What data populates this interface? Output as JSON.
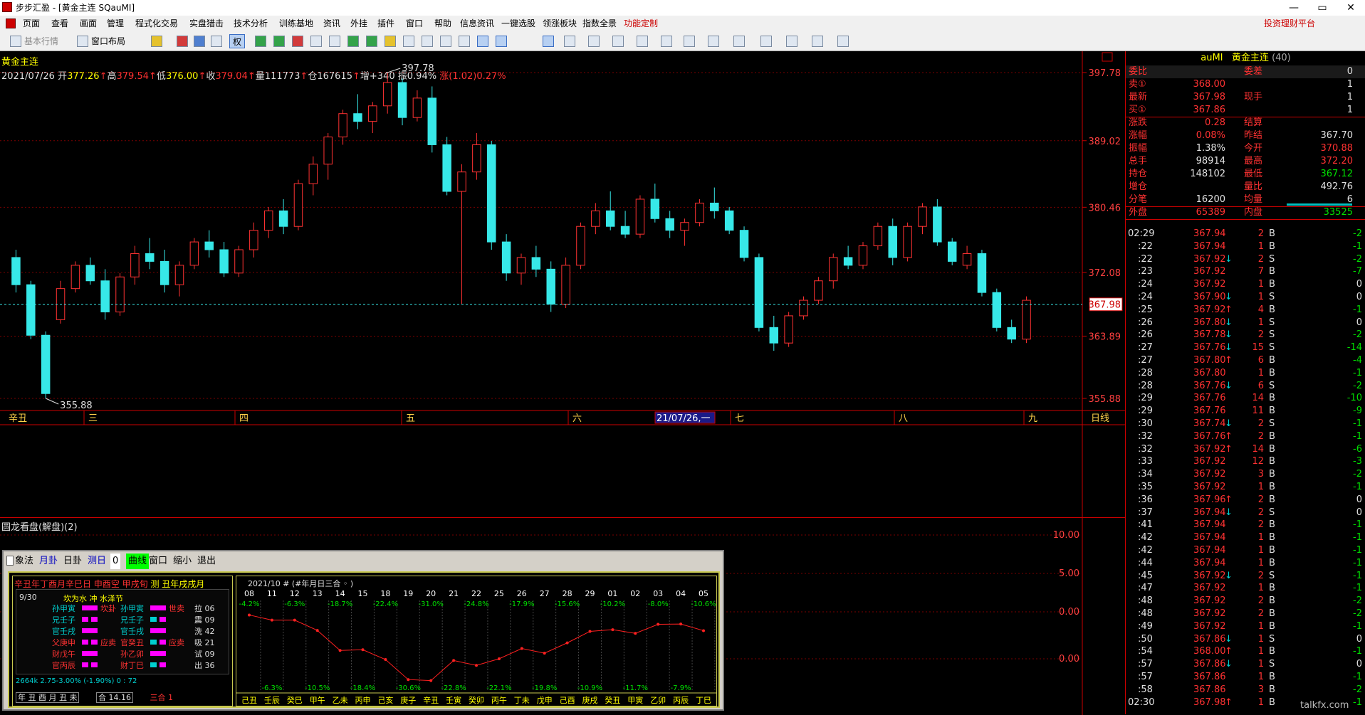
{
  "window": {
    "title": "步步汇盈 - [黄金主连 SQauMI]",
    "min": "—",
    "max": "▭",
    "close": "✕"
  },
  "menu": {
    "items": [
      "页面",
      "查看",
      "画面",
      "管理",
      "程式化交易",
      "实盘猎击",
      "技术分析",
      "训练基地",
      "资讯",
      "外挂",
      "插件",
      "窗口",
      "帮助",
      "信息资讯",
      "一键选股",
      "领涨板块",
      "指数全景",
      "功能定制"
    ],
    "platform": "投资理财平台"
  },
  "toolbar": {
    "basic_quotes": "基本行情",
    "window_layout": "窗口布局",
    "quan": "权"
  },
  "chart": {
    "title": "黄金主连",
    "date": "2021/07/26",
    "open_label": "开",
    "open": "377.26",
    "high_label": "高",
    "high": "379.54",
    "low_label": "低",
    "low": "376.00",
    "close_label": "收",
    "close": "379.04",
    "vol_label": "量",
    "vol": "111773",
    "oi_label": "仓",
    "oi": "167615",
    "inc_label": "增",
    "inc": "+340",
    "amp_label": "振",
    "amp": "0.94%",
    "chg_label": "涨",
    "chg": "(1.02)0.27%",
    "current_price": "367.98",
    "peak_label": "397.78",
    "trough_label": "355.88",
    "axis_ticks": [
      "397.78",
      "389.02",
      "380.46",
      "372.08",
      "363.89",
      "355.88"
    ],
    "x_labels": [
      "辛丑",
      "三",
      "四",
      "五",
      "六",
      "21/07/26,一",
      "七",
      "八",
      "九"
    ],
    "period_label": "日线",
    "colors": {
      "up": "#ff3232",
      "down": "#37e8e8",
      "bg": "#000000"
    }
  },
  "chart_data": {
    "type": "candlestick",
    "title": "黄金主连",
    "ylim": [
      355.88,
      397.78
    ],
    "candles": [
      [
        374.0,
        375.0,
        369.5,
        370.5
      ],
      [
        370.5,
        371.0,
        363.5,
        364.0
      ],
      [
        364.0,
        364.5,
        355.88,
        356.5
      ],
      [
        366.0,
        371.0,
        365.5,
        370.0
      ],
      [
        370.0,
        373.5,
        369.5,
        373.0
      ],
      [
        373.0,
        374.0,
        370.5,
        371.0
      ],
      [
        371.0,
        372.5,
        366.0,
        367.0
      ],
      [
        367.0,
        372.0,
        366.5,
        371.5
      ],
      [
        371.5,
        375.5,
        370.5,
        374.5
      ],
      [
        374.5,
        376.5,
        372.5,
        373.5
      ],
      [
        373.5,
        375.0,
        369.5,
        370.5
      ],
      [
        370.5,
        373.5,
        369.0,
        373.0
      ],
      [
        373.0,
        376.5,
        372.5,
        376.0
      ],
      [
        376.0,
        377.5,
        374.0,
        375.0
      ],
      [
        375.0,
        376.0,
        371.5,
        372.0
      ],
      [
        372.0,
        375.5,
        371.5,
        375.0
      ],
      [
        375.0,
        378.5,
        374.0,
        377.5
      ],
      [
        377.5,
        380.5,
        376.5,
        380.0
      ],
      [
        380.0,
        381.5,
        377.0,
        378.0
      ],
      [
        378.0,
        384.0,
        377.5,
        383.5
      ],
      [
        383.5,
        387.0,
        382.0,
        386.0
      ],
      [
        386.0,
        390.0,
        384.0,
        389.5
      ],
      [
        389.5,
        393.0,
        388.5,
        392.5
      ],
      [
        392.5,
        395.0,
        390.5,
        391.5
      ],
      [
        391.5,
        394.0,
        390.0,
        393.5
      ],
      [
        393.5,
        397.78,
        392.5,
        396.5
      ],
      [
        396.5,
        397.0,
        391.0,
        392.0
      ],
      [
        392.0,
        395.5,
        391.5,
        394.5
      ],
      [
        394.5,
        396.0,
        387.5,
        388.5
      ],
      [
        388.5,
        389.5,
        382.0,
        382.5
      ],
      [
        382.5,
        386.0,
        368.0,
        385.0
      ],
      [
        385.0,
        390.0,
        384.0,
        388.5
      ],
      [
        388.5,
        389.0,
        375.0,
        376.0
      ],
      [
        376.0,
        377.0,
        371.0,
        372.0
      ],
      [
        372.0,
        374.5,
        370.5,
        374.0
      ],
      [
        374.0,
        375.5,
        371.5,
        372.5
      ],
      [
        372.5,
        373.5,
        367.0,
        368.0
      ],
      [
        368.0,
        374.0,
        367.5,
        373.0
      ],
      [
        373.0,
        378.5,
        372.5,
        378.0
      ],
      [
        378.0,
        381.0,
        377.0,
        380.0
      ],
      [
        380.0,
        382.5,
        377.5,
        378.0
      ],
      [
        378.0,
        380.0,
        376.5,
        377.0
      ],
      [
        377.0,
        382.0,
        376.5,
        381.5
      ],
      [
        381.5,
        383.5,
        378.5,
        379.0
      ],
      [
        379.0,
        380.0,
        376.5,
        377.5
      ],
      [
        377.5,
        379.0,
        375.5,
        378.5
      ],
      [
        378.5,
        381.5,
        378.0,
        381.0
      ],
      [
        381.0,
        383.0,
        379.0,
        380.0
      ],
      [
        380.0,
        380.5,
        377.0,
        377.5
      ],
      [
        377.5,
        378.0,
        373.5,
        374.0
      ],
      [
        374.0,
        374.5,
        364.5,
        365.0
      ],
      [
        365.0,
        366.5,
        362.0,
        363.0
      ],
      [
        363.0,
        367.0,
        362.5,
        366.5
      ],
      [
        366.5,
        369.0,
        366.0,
        368.5
      ],
      [
        368.5,
        371.5,
        368.0,
        371.0
      ],
      [
        371.0,
        374.5,
        370.0,
        374.0
      ],
      [
        374.0,
        375.5,
        372.5,
        373.0
      ],
      [
        373.0,
        376.0,
        372.5,
        375.5
      ],
      [
        375.5,
        378.5,
        375.0,
        378.0
      ],
      [
        378.0,
        379.0,
        373.0,
        374.0
      ],
      [
        374.0,
        378.5,
        373.5,
        378.0
      ],
      [
        378.0,
        381.0,
        377.0,
        380.5
      ],
      [
        380.5,
        381.5,
        375.5,
        376.0
      ],
      [
        376.0,
        376.5,
        373.0,
        373.5
      ],
      [
        373.0,
        375.5,
        372.5,
        374.5
      ],
      [
        374.5,
        375.0,
        369.0,
        369.5
      ],
      [
        369.5,
        370.0,
        364.5,
        365.0
      ],
      [
        365.0,
        366.0,
        363.0,
        363.5
      ],
      [
        363.5,
        369.0,
        363.0,
        368.5
      ]
    ]
  },
  "quote": {
    "code": "auMI",
    "name": "黄金主连",
    "count": "(40)",
    "rows": [
      {
        "k1": "委比",
        "v1": "",
        "k2": "委差",
        "v2": "0"
      },
      {
        "k1": "卖①",
        "v1": "368.00",
        "k2": "",
        "v2": "1"
      },
      {
        "k1": "最新",
        "v1": "367.98",
        "k2": "现手",
        "v2": "1"
      },
      {
        "k1": "买①",
        "v1": "367.86",
        "k2": "",
        "v2": "1"
      },
      {
        "k1": "涨跌",
        "v1": "0.28",
        "k2": "结算",
        "v2": ""
      },
      {
        "k1": "涨幅",
        "v1": "0.08%",
        "k2": "昨结",
        "v2": "367.70"
      },
      {
        "k1": "振幅",
        "v1": "1.38%",
        "k2": "今开",
        "v2": "370.88"
      },
      {
        "k1": "总手",
        "v1": "98914",
        "k2": "最高",
        "v2": "372.20"
      },
      {
        "k1": "持仓",
        "v1": "148102",
        "k2": "最低",
        "v2": "367.12"
      },
      {
        "k1": "增仓",
        "v1": "",
        "k2": "量比",
        "v2": "492.76"
      },
      {
        "k1": "分笔",
        "v1": "16200",
        "k2": "均量",
        "v2": "6"
      },
      {
        "k1": "外盘",
        "v1": "65389",
        "k2": "内盘",
        "v2": "33525"
      }
    ]
  },
  "ticks": [
    [
      "02:29",
      "367.94",
      "",
      "2",
      "B",
      "-2"
    ],
    [
      ":22",
      "367.94",
      "",
      "1",
      "B",
      "-1"
    ],
    [
      ":22",
      "367.92",
      "↓",
      "2",
      "S",
      "-2"
    ],
    [
      ":23",
      "367.92",
      "",
      "7",
      "B",
      "-7"
    ],
    [
      ":24",
      "367.92",
      "",
      "1",
      "B",
      "0"
    ],
    [
      ":24",
      "367.90",
      "↓",
      "1",
      "S",
      "0"
    ],
    [
      ":25",
      "367.92",
      "↑",
      "4",
      "B",
      "-1"
    ],
    [
      ":26",
      "367.80",
      "↓",
      "1",
      "S",
      "0"
    ],
    [
      ":26",
      "367.78",
      "↓",
      "2",
      "S",
      "-2"
    ],
    [
      ":27",
      "367.76",
      "↓",
      "15",
      "S",
      "-14"
    ],
    [
      ":27",
      "367.80",
      "↑",
      "6",
      "B",
      "-4"
    ],
    [
      ":28",
      "367.80",
      "",
      "1",
      "B",
      "-1"
    ],
    [
      ":28",
      "367.76",
      "↓",
      "6",
      "S",
      "-2"
    ],
    [
      ":29",
      "367.76",
      "",
      "14",
      "B",
      "-10"
    ],
    [
      ":29",
      "367.76",
      "",
      "11",
      "B",
      "-9"
    ],
    [
      ":30",
      "367.74",
      "↓",
      "2",
      "S",
      "-1"
    ],
    [
      ":32",
      "367.76",
      "↑",
      "2",
      "B",
      "-1"
    ],
    [
      ":32",
      "367.92",
      "↑",
      "14",
      "B",
      "-6"
    ],
    [
      ":33",
      "367.92",
      "",
      "12",
      "B",
      "-3"
    ],
    [
      ":34",
      "367.92",
      "",
      "3",
      "B",
      "-2"
    ],
    [
      ":35",
      "367.92",
      "",
      "1",
      "B",
      "-1"
    ],
    [
      ":36",
      "367.96",
      "↑",
      "2",
      "B",
      "0"
    ],
    [
      ":37",
      "367.94",
      "↓",
      "2",
      "S",
      "0"
    ],
    [
      ":41",
      "367.94",
      "",
      "2",
      "B",
      "-1"
    ],
    [
      ":42",
      "367.94",
      "",
      "1",
      "B",
      "-1"
    ],
    [
      ":42",
      "367.94",
      "",
      "1",
      "B",
      "-1"
    ],
    [
      ":44",
      "367.94",
      "",
      "1",
      "B",
      "-1"
    ],
    [
      ":45",
      "367.92",
      "↓",
      "2",
      "S",
      "-1"
    ],
    [
      ":47",
      "367.92",
      "",
      "1",
      "B",
      "-1"
    ],
    [
      ":48",
      "367.92",
      "",
      "2",
      "B",
      "-2"
    ],
    [
      ":48",
      "367.92",
      "",
      "2",
      "B",
      "-2"
    ],
    [
      ":49",
      "367.92",
      "",
      "1",
      "B",
      "-1"
    ],
    [
      ":50",
      "367.86",
      "↓",
      "1",
      "S",
      "0"
    ],
    [
      ":54",
      "368.00",
      "↑",
      "1",
      "B",
      "-1"
    ],
    [
      ":57",
      "367.86",
      "↓",
      "1",
      "S",
      "0"
    ],
    [
      ":57",
      "367.86",
      "",
      "1",
      "B",
      "-1"
    ],
    [
      ":58",
      "367.86",
      "",
      "3",
      "B",
      "-2"
    ],
    [
      "02:30",
      "367.98",
      "↑",
      "1",
      "B",
      "-1"
    ]
  ],
  "lower": {
    "title": "圆龙看盘(解盘)(2)",
    "ticks": [
      "10.00",
      "5.00",
      "0.00",
      "0.00"
    ]
  },
  "dialog": {
    "toolbar": [
      "象法",
      "月卦",
      "日卦",
      "测日",
      "0",
      "曲线",
      "窗口",
      "缩小",
      "退出"
    ],
    "header": "辛丑年丁酉月辛巳日 申酉空 甲戌旬",
    "header2": "测 丑年戌戌月",
    "date_label": "9/30",
    "gua_top": "坎为水  冲  水泽节",
    "rows_left": [
      "孙甲寅",
      "兄壬子",
      "官壬戌",
      "父庚申",
      "财戊午",
      "官丙辰"
    ],
    "rows_left_tag": [
      "坎卦",
      "",
      "",
      "应卖",
      "",
      ""
    ],
    "rows_right": [
      "孙甲寅",
      "兄壬子",
      "官壬戌",
      "官癸丑",
      "孙乙卯",
      "财丁巳"
    ],
    "rows_right_tag": [
      "世卖",
      "",
      "",
      "应卖",
      "",
      ""
    ],
    "rows_right_val": [
      "拉 06",
      "震 09",
      "洗 42",
      "吸 21",
      "试 09",
      "出 36"
    ],
    "footer1": "2664k 2.75-3.00% (-1.90%)  0 : 72",
    "footer2_left": "年 丑 酉 月 丑 未",
    "footer2_mid": "合 14.16",
    "footer2_right": "三合 1",
    "chart_header": "2021/10  # (#年月日三合 ◦ )",
    "chart_days": [
      "08",
      "11",
      "12",
      "13",
      "14",
      "15",
      "18",
      "19",
      "20",
      "21",
      "22",
      "25",
      "26",
      "27",
      "28",
      "29",
      "01",
      "02",
      "03",
      "04",
      "05"
    ],
    "chart_pct_top": [
      "-4.2%",
      "",
      "-6.3%",
      "",
      "-18.7%",
      "",
      "-22.4%",
      "",
      "-31.0%",
      "",
      "-24.8%",
      "",
      "-17.9%",
      "",
      "-15.6%",
      "",
      "-10.2%",
      "",
      "-8.0%",
      "",
      "-10.6%"
    ],
    "chart_pct_bottom": [
      "",
      "-6.3%",
      "",
      "-10.5%",
      "",
      "-18.4%",
      "",
      "-30.6%",
      "",
      "-22.8%",
      "",
      "-22.1%",
      "",
      "-19.8%",
      "",
      "-10.9%",
      "",
      "-11.7%",
      "",
      "-7.9%",
      ""
    ],
    "chart_gz": [
      "己丑",
      "壬辰",
      "癸巳",
      "甲午",
      "乙未",
      "丙申",
      "己亥",
      "庚子",
      "辛丑",
      "壬寅",
      "癸卯",
      "丙午",
      "丁未",
      "戊申",
      "己酉",
      "庚戌",
      "癸丑",
      "甲寅",
      "乙卯",
      "丙辰",
      "丁巳"
    ],
    "chart_values": [
      -4.2,
      -6.3,
      -6.3,
      -10.5,
      -18.7,
      -18.4,
      -22.4,
      -30.6,
      -31.0,
      -22.8,
      -24.8,
      -22.1,
      -17.9,
      -19.8,
      -15.6,
      -10.9,
      -10.2,
      -11.7,
      -8.0,
      -7.9,
      -10.6
    ]
  },
  "bottom_text": "talkfx.com"
}
